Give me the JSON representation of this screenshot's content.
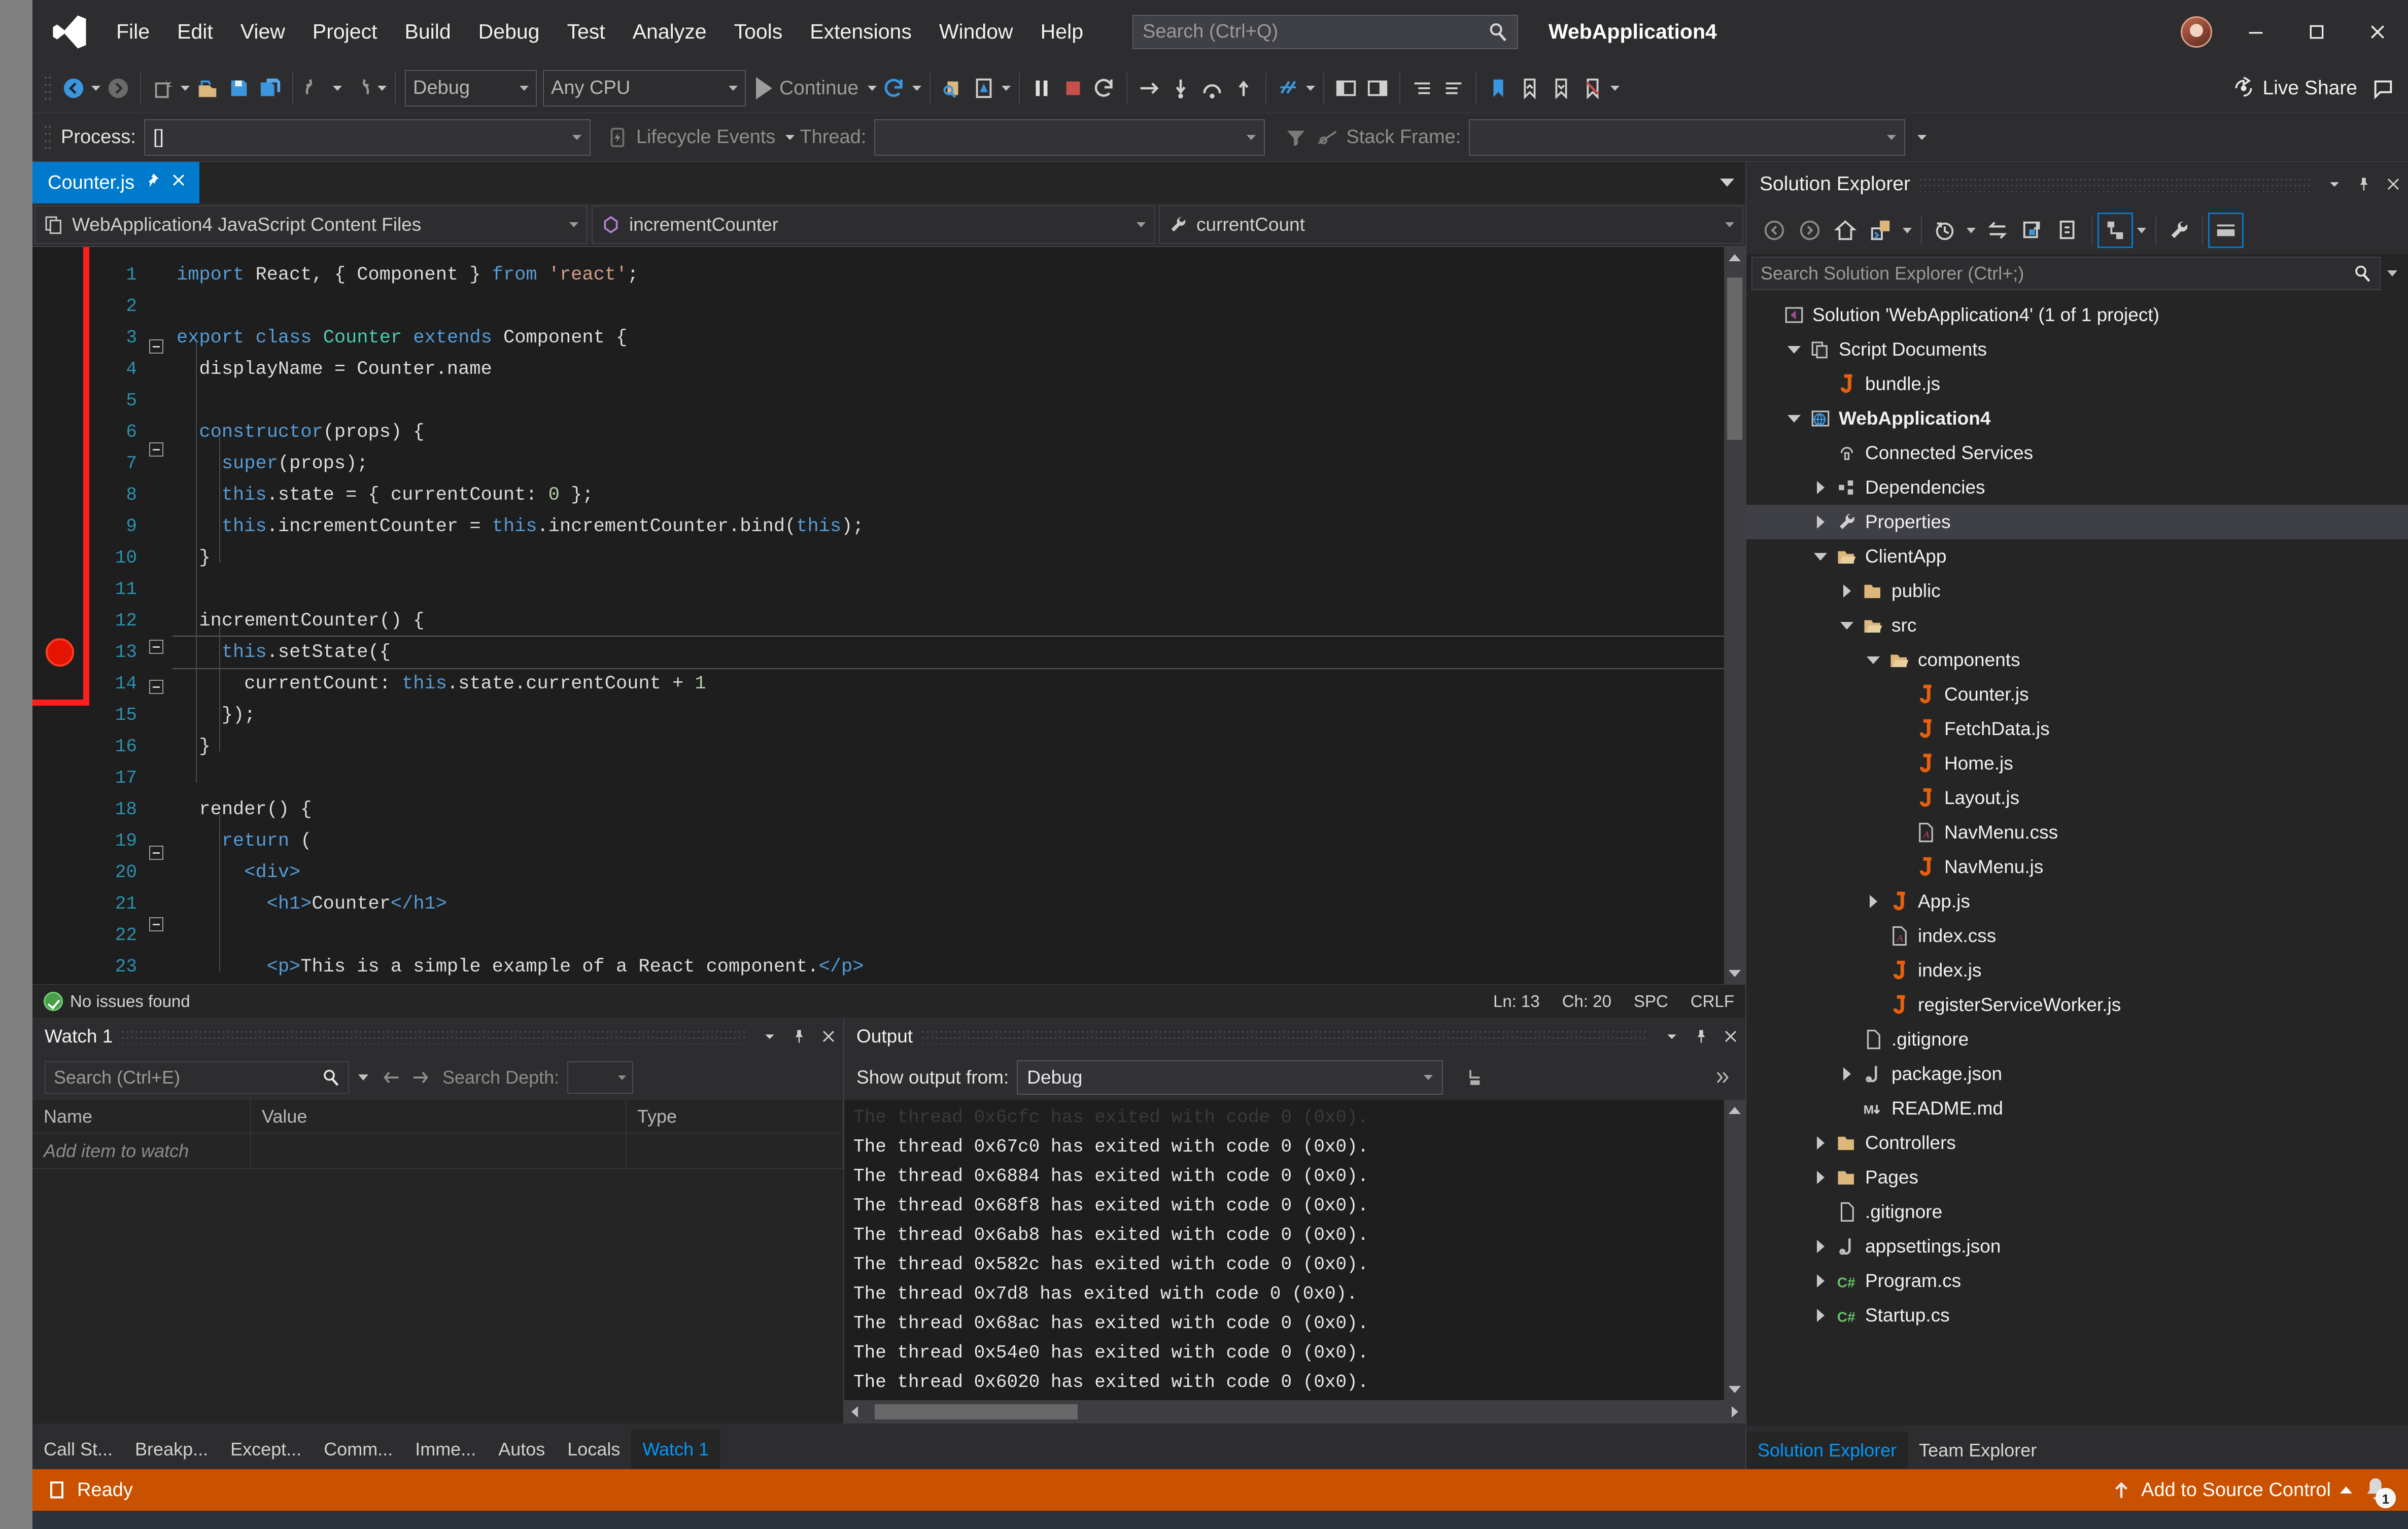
{
  "window": {
    "solution_title": "WebApplication4",
    "logo_icon": "visual-studio-logo-icon",
    "minimize_icon": "minimize-icon",
    "maximize_icon": "maximize-icon",
    "close_icon": "close-icon",
    "avatar_icon": "user-avatar"
  },
  "menu": {
    "items": [
      {
        "label": "File"
      },
      {
        "label": "Edit"
      },
      {
        "label": "View"
      },
      {
        "label": "Project"
      },
      {
        "label": "Build"
      },
      {
        "label": "Debug"
      },
      {
        "label": "Test"
      },
      {
        "label": "Analyze"
      },
      {
        "label": "Tools"
      },
      {
        "label": "Extensions"
      },
      {
        "label": "Window"
      },
      {
        "label": "Help"
      }
    ]
  },
  "quick_search": {
    "placeholder": "Search (Ctrl+Q)",
    "value": "",
    "icon": "search-icon"
  },
  "toolbar": {
    "back_label": "Navigate Backward",
    "forward_label": "Navigate Forward",
    "new_label": "New Project",
    "open_label": "Open File",
    "save_label": "Save",
    "save_all_label": "Save All",
    "undo_label": "Undo",
    "redo_label": "Redo",
    "configuration": "Debug",
    "platform": "Any CPU",
    "run_label": "Continue",
    "restart_label": "Restart",
    "live_share_label": "Live Share"
  },
  "debug_bar": {
    "process_label": "Process:",
    "process_value": "[]",
    "lifecycle_label": "Lifecycle Events",
    "thread_label": "Thread:",
    "thread_value": "",
    "stack_frame_label": "Stack Frame:",
    "stack_frame_value": ""
  },
  "editor": {
    "tab": {
      "label": "Counter.js",
      "pin_icon": "pin-icon",
      "close_icon": "close-icon"
    },
    "nav": {
      "project_scope": "WebApplication4 JavaScript Content Files",
      "member_scope": "incrementCounter",
      "symbol_scope": "currentCount"
    },
    "lines": [
      {
        "n": 1,
        "fold": "minus-hidden",
        "html": "<span class=\"k\">import</span> React, { Component } <span class=\"k\">from</span> <span class=\"s\">'react'</span>;",
        "indent": 0
      },
      {
        "n": 2,
        "fold": "",
        "html": "",
        "indent": 0
      },
      {
        "n": 3,
        "fold": "minus",
        "html": "<span class=\"k\">export</span> <span class=\"k\">class</span> <span class=\"t\">Counter</span> <span class=\"k\">extends</span> Component {",
        "indent": 0
      },
      {
        "n": 4,
        "fold": "",
        "html": "  displayName = Counter.name",
        "indent": 1
      },
      {
        "n": 5,
        "fold": "",
        "html": "",
        "indent": 1
      },
      {
        "n": 6,
        "fold": "minus",
        "html": "  <span class=\"k\">constructor</span>(props) {",
        "indent": 1
      },
      {
        "n": 7,
        "fold": "",
        "html": "    <span class=\"k\">super</span>(props);",
        "indent": 2
      },
      {
        "n": 8,
        "fold": "",
        "html": "    <span class=\"k\">this</span>.state = { currentCount: <span class=\"n\">0</span> };",
        "indent": 2
      },
      {
        "n": 9,
        "fold": "",
        "html": "    <span class=\"k\">this</span>.incrementCounter = <span class=\"k\">this</span>.incrementCounter.bind(<span class=\"k\">this</span>);",
        "indent": 2
      },
      {
        "n": 10,
        "fold": "",
        "html": "  }",
        "indent": 1
      },
      {
        "n": 11,
        "fold": "",
        "html": "",
        "indent": 1
      },
      {
        "n": 12,
        "fold": "minus",
        "html": "  incrementCounter() {",
        "indent": 1
      },
      {
        "n": 13,
        "fold": "minus",
        "html": "    <span class=\"k\">this</span>.setState({",
        "indent": 2,
        "highlight": true
      },
      {
        "n": 14,
        "fold": "",
        "html": "      currentCount: <span class=\"k\">this</span>.state.currentCount + <span class=\"n\">1</span>",
        "indent": 3
      },
      {
        "n": 15,
        "fold": "",
        "html": "    });",
        "indent": 2
      },
      {
        "n": 16,
        "fold": "",
        "html": "  }",
        "indent": 1
      },
      {
        "n": 17,
        "fold": "",
        "html": "",
        "indent": 1
      },
      {
        "n": 18,
        "fold": "minus",
        "html": "  render() {",
        "indent": 1
      },
      {
        "n": 19,
        "fold": "",
        "html": "    <span class=\"k\">return</span> (",
        "indent": 2
      },
      {
        "n": 20,
        "fold": "minus",
        "html": "      <span class=\"tag\">&lt;div&gt;</span>",
        "indent": 3
      },
      {
        "n": 21,
        "fold": "",
        "html": "        <span class=\"tag\">&lt;h1&gt;</span>Counter<span class=\"tag\">&lt;/h1&gt;</span>",
        "indent": 4
      },
      {
        "n": 22,
        "fold": "",
        "html": "",
        "indent": 4
      },
      {
        "n": 23,
        "fold": "",
        "html": "        <span class=\"tag\">&lt;p&gt;</span>This is a simple example of a React component.<span class=\"tag\">&lt;/p&gt;</span>",
        "indent": 4
      }
    ],
    "breakpoint_line": 13,
    "status": {
      "issues": "No issues found",
      "line": "Ln: 13",
      "column": "Ch: 20",
      "spaces": "SPC",
      "eol": "CRLF"
    }
  },
  "watch_panel": {
    "title": "Watch 1",
    "search_placeholder": "Search (Ctrl+E)",
    "search_value": "",
    "search_depth_label": "Search Depth:",
    "search_depth_value": "",
    "columns": [
      "Name",
      "Value",
      "Type"
    ],
    "rows": [
      {
        "name": "Add item to watch",
        "value": "",
        "type": ""
      }
    ],
    "dropdown_icon": "chevron-down-icon",
    "pin_icon": "pin-icon",
    "close_icon": "close-icon"
  },
  "output_panel": {
    "title": "Output",
    "show_output_from_label": "Show output from:",
    "source": "Debug",
    "lines": [
      "The thread 0x6cfc has exited with code 0 (0x0).",
      "The thread 0x67c0 has exited with code 0 (0x0).",
      "The thread 0x6884 has exited with code 0 (0x0).",
      "The thread 0x68f8 has exited with code 0 (0x0).",
      "The thread 0x6ab8 has exited with code 0 (0x0).",
      "The thread 0x582c has exited with code 0 (0x0).",
      "The thread 0x7d8 has exited with code 0 (0x0).",
      "The thread 0x68ac has exited with code 0 (0x0).",
      "The thread 0x54e0 has exited with code 0 (0x0).",
      "The thread 0x6020 has exited with code 0 (0x0)."
    ]
  },
  "bottom_tabs": {
    "items": [
      {
        "label": "Call St...",
        "active": false
      },
      {
        "label": "Breakp...",
        "active": false
      },
      {
        "label": "Except...",
        "active": false
      },
      {
        "label": "Comm...",
        "active": false
      },
      {
        "label": "Imme...",
        "active": false
      },
      {
        "label": "Autos",
        "active": false
      },
      {
        "label": "Locals",
        "active": false
      },
      {
        "label": "Watch 1",
        "active": true
      }
    ]
  },
  "solution_explorer": {
    "title": "Solution Explorer",
    "search_placeholder": "Search Solution Explorer (Ctrl+;)",
    "search_value": "",
    "toolbar": {
      "back": "back-icon",
      "forward": "forward-icon",
      "home": "home-icon",
      "pending_changes": "pending-changes-icon",
      "history": "history-icon",
      "sync": "sync-with-active-document-icon",
      "refresh": "refresh-icon",
      "collapse_all": "collapse-all-icon",
      "show_all_files": "show-all-files-icon",
      "properties": "properties-wrench-icon",
      "preview": "preview-selected-items-icon"
    },
    "tree": [
      {
        "label": "Solution 'WebApplication4' (1 of 1 project)",
        "depth": 0,
        "twisty": "none",
        "icon": "solution-icon",
        "bold": false,
        "selected": false
      },
      {
        "label": "Script Documents",
        "depth": 1,
        "twisty": "down",
        "icon": "script-documents-icon",
        "bold": false,
        "selected": false
      },
      {
        "label": "bundle.js",
        "depth": 2,
        "twisty": "none",
        "icon": "js-file-icon",
        "bold": false,
        "selected": false
      },
      {
        "label": "WebApplication4",
        "depth": 1,
        "twisty": "down",
        "icon": "web-project-icon",
        "bold": true,
        "selected": false
      },
      {
        "label": "Connected Services",
        "depth": 2,
        "twisty": "none",
        "icon": "connected-services-icon",
        "bold": false,
        "selected": false
      },
      {
        "label": "Dependencies",
        "depth": 2,
        "twisty": "right",
        "icon": "dependencies-icon",
        "bold": false,
        "selected": false
      },
      {
        "label": "Properties",
        "depth": 2,
        "twisty": "right",
        "icon": "wrench-icon",
        "bold": false,
        "selected": true
      },
      {
        "label": "ClientApp",
        "depth": 2,
        "twisty": "down",
        "icon": "folder-open-icon",
        "bold": false,
        "selected": false
      },
      {
        "label": "public",
        "depth": 3,
        "twisty": "right",
        "icon": "folder-icon",
        "bold": false,
        "selected": false
      },
      {
        "label": "src",
        "depth": 3,
        "twisty": "down",
        "icon": "folder-open-icon",
        "bold": false,
        "selected": false
      },
      {
        "label": "components",
        "depth": 4,
        "twisty": "down",
        "icon": "folder-open-icon",
        "bold": false,
        "selected": false
      },
      {
        "label": "Counter.js",
        "depth": 5,
        "twisty": "none",
        "icon": "js-file-icon",
        "bold": false,
        "selected": false
      },
      {
        "label": "FetchData.js",
        "depth": 5,
        "twisty": "none",
        "icon": "js-file-icon",
        "bold": false,
        "selected": false
      },
      {
        "label": "Home.js",
        "depth": 5,
        "twisty": "none",
        "icon": "js-file-icon",
        "bold": false,
        "selected": false
      },
      {
        "label": "Layout.js",
        "depth": 5,
        "twisty": "none",
        "icon": "js-file-icon",
        "bold": false,
        "selected": false
      },
      {
        "label": "NavMenu.css",
        "depth": 5,
        "twisty": "none",
        "icon": "css-file-icon",
        "bold": false,
        "selected": false
      },
      {
        "label": "NavMenu.js",
        "depth": 5,
        "twisty": "none",
        "icon": "js-file-icon",
        "bold": false,
        "selected": false
      },
      {
        "label": "App.js",
        "depth": 4,
        "twisty": "right",
        "icon": "js-file-icon",
        "bold": false,
        "selected": false
      },
      {
        "label": "index.css",
        "depth": 4,
        "twisty": "none",
        "icon": "css-file-icon",
        "bold": false,
        "selected": false
      },
      {
        "label": "index.js",
        "depth": 4,
        "twisty": "none",
        "icon": "js-file-icon",
        "bold": false,
        "selected": false
      },
      {
        "label": "registerServiceWorker.js",
        "depth": 4,
        "twisty": "none",
        "icon": "js-file-icon",
        "bold": false,
        "selected": false
      },
      {
        "label": ".gitignore",
        "depth": 3,
        "twisty": "none",
        "icon": "text-file-icon",
        "bold": false,
        "selected": false
      },
      {
        "label": "package.json",
        "depth": 3,
        "twisty": "right",
        "icon": "json-file-icon",
        "bold": false,
        "selected": false
      },
      {
        "label": "README.md",
        "depth": 3,
        "twisty": "none",
        "icon": "markdown-file-icon",
        "bold": false,
        "selected": false
      },
      {
        "label": "Controllers",
        "depth": 2,
        "twisty": "right",
        "icon": "folder-icon",
        "bold": false,
        "selected": false
      },
      {
        "label": "Pages",
        "depth": 2,
        "twisty": "right",
        "icon": "folder-icon",
        "bold": false,
        "selected": false
      },
      {
        "label": ".gitignore",
        "depth": 2,
        "twisty": "none",
        "icon": "text-file-icon",
        "bold": false,
        "selected": false
      },
      {
        "label": "appsettings.json",
        "depth": 2,
        "twisty": "right",
        "icon": "json-file-icon",
        "bold": false,
        "selected": false
      },
      {
        "label": "Program.cs",
        "depth": 2,
        "twisty": "right",
        "icon": "csharp-file-icon",
        "bold": false,
        "selected": false
      },
      {
        "label": "Startup.cs",
        "depth": 2,
        "twisty": "right",
        "icon": "csharp-file-icon",
        "bold": false,
        "selected": false
      }
    ],
    "tabs": [
      {
        "label": "Solution Explorer",
        "active": true
      },
      {
        "label": "Team Explorer",
        "active": false
      }
    ]
  },
  "status_bar": {
    "ready": "Ready",
    "source_control": "Add to Source Control",
    "notification_count": "1",
    "bg_color": "#ca5100"
  },
  "colors": {
    "accent": "#007acc",
    "tab_active": "#007acc",
    "status_orange": "#ca5100",
    "breakpoint_red": "#e51400",
    "annotation_red": "#ff1f1f",
    "keyword_blue": "#569cd6",
    "type_teal": "#4ec9b0",
    "string_orange": "#d69d85",
    "number_green": "#b5cea8"
  }
}
